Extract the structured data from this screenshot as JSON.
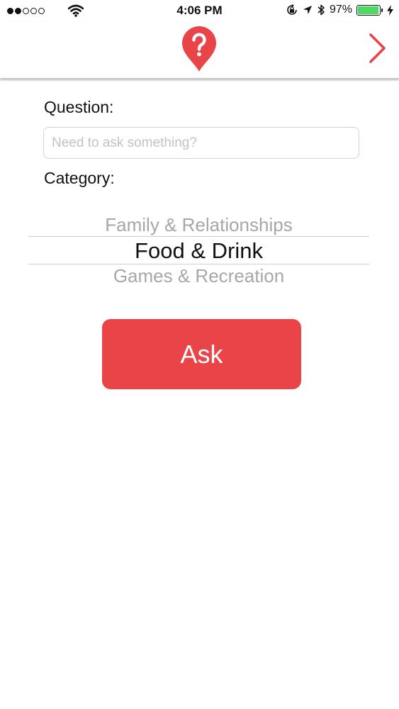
{
  "status_bar": {
    "time": "4:06 PM",
    "battery_percent": "97%",
    "battery_level": 0.97,
    "signal_filled": 2,
    "signal_total": 5,
    "icons": [
      "wifi-icon",
      "orientation-lock-icon",
      "location-arrow-icon",
      "bluetooth-icon",
      "battery-icon",
      "charging-bolt-icon"
    ]
  },
  "nav": {
    "logo_icon": "question-pin-icon",
    "next_icon": "chevron-right-icon"
  },
  "form": {
    "question_label": "Question:",
    "question_placeholder": "Need to ask something?",
    "question_value": "",
    "category_label": "Category:"
  },
  "picker": {
    "items": [
      "Family & Relationships",
      "Food & Drink",
      "Games & Recreation"
    ],
    "selected": "Food & Drink"
  },
  "ask_button": {
    "label": "Ask"
  },
  "colors": {
    "accent": "#e94548",
    "battery": "#4cd964",
    "placeholder": "#c2c2c7",
    "picker_inactive": "#a7a7ab"
  }
}
